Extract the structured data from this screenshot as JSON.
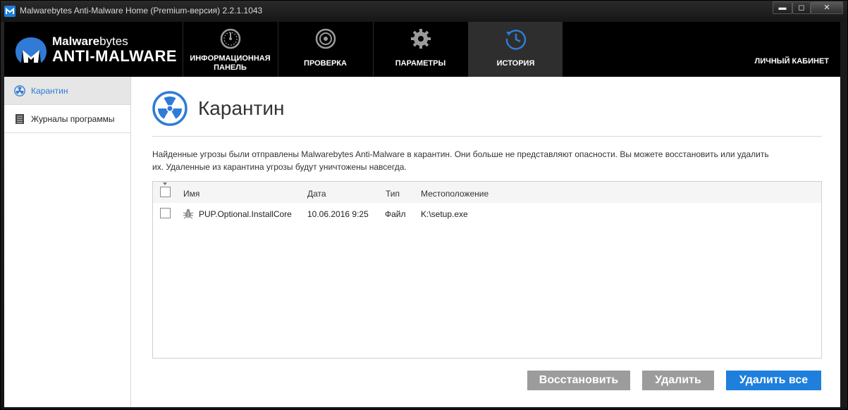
{
  "window": {
    "title": "Malwarebytes Anti-Malware Home (Premium-версия) 2.2.1.1043",
    "minimize": "▬",
    "maximize": "◻",
    "close": "✕"
  },
  "logo": {
    "brand_bold": "Malware",
    "brand_light": "bytes",
    "product": "ANTI-MALWARE"
  },
  "nav": {
    "tabs": [
      {
        "label_line1": "ИНФОРМАЦИОННАЯ",
        "label_line2": "ПАНЕЛЬ",
        "icon": "dashboard-gauge-icon"
      },
      {
        "label": "ПРОВЕРКА",
        "icon": "scan-target-icon"
      },
      {
        "label": "ПАРАМЕТРЫ",
        "icon": "gear-icon"
      },
      {
        "label": "ИСТОРИЯ",
        "icon": "history-clock-icon",
        "active": true
      }
    ],
    "account": "ЛИЧНЫЙ КАБИНЕТ"
  },
  "sidebar": {
    "items": [
      {
        "label": "Карантин",
        "icon": "radiation-icon",
        "active": true
      },
      {
        "label": "Журналы программы",
        "icon": "log-document-icon"
      }
    ]
  },
  "main": {
    "title": "Карантин",
    "description_line1": "Найденные угрозы были отправлены Malwarebytes Anti-Malware в карантин. Они больше не представляют опасности. Вы можете восстановить или удалить",
    "description_line2": "их. Удаленные из карантина угрозы будут уничтожены навсегда.",
    "table": {
      "columns": [
        "Имя",
        "Дата",
        "Тип",
        "Местоположение"
      ],
      "rows": [
        {
          "name": "PUP.Optional.InstallCore",
          "date": "10.06.2016 9:25",
          "type": "Файл",
          "location": "K:\\setup.exe",
          "checked": false
        }
      ]
    },
    "buttons": {
      "restore": "Восстановить",
      "delete": "Удалить",
      "delete_all": "Удалить все"
    }
  },
  "colors": {
    "accent": "#1e7fdc",
    "button_gray": "#9c9c9c",
    "header_bg": "#000000"
  }
}
